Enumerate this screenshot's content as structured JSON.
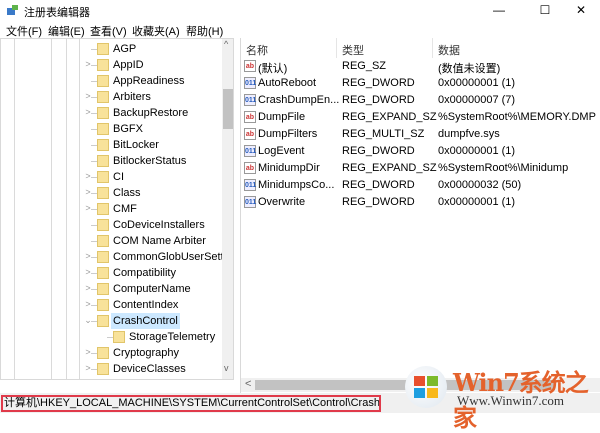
{
  "window": {
    "title": "注册表编辑器",
    "minimize": "—",
    "maximize": "☐",
    "close": "✕"
  },
  "menu": [
    "文件(F)",
    "编辑(E)",
    "查看(V)",
    "收藏夹(A)",
    "帮助(H)"
  ],
  "tree": [
    {
      "label": "AGP",
      "exp": ""
    },
    {
      "label": "AppID",
      "exp": ">"
    },
    {
      "label": "AppReadiness",
      "exp": ""
    },
    {
      "label": "Arbiters",
      "exp": ">"
    },
    {
      "label": "BackupRestore",
      "exp": ">"
    },
    {
      "label": "BGFX",
      "exp": ""
    },
    {
      "label": "BitLocker",
      "exp": ""
    },
    {
      "label": "BitlockerStatus",
      "exp": ""
    },
    {
      "label": "CI",
      "exp": ">"
    },
    {
      "label": "Class",
      "exp": ">"
    },
    {
      "label": "CMF",
      "exp": ">"
    },
    {
      "label": "CoDeviceInstallers",
      "exp": ""
    },
    {
      "label": "COM Name Arbiter",
      "exp": ""
    },
    {
      "label": "CommonGlobUserSettings",
      "exp": ">"
    },
    {
      "label": "Compatibility",
      "exp": ">"
    },
    {
      "label": "ComputerName",
      "exp": ">"
    },
    {
      "label": "ContentIndex",
      "exp": ">"
    },
    {
      "label": "CrashControl",
      "exp": "⌄",
      "selected": true
    },
    {
      "label": "StorageTelemetry",
      "exp": "",
      "child": true
    },
    {
      "label": "Cryptography",
      "exp": ">"
    },
    {
      "label": "DeviceClasses",
      "exp": ">"
    }
  ],
  "columns": {
    "name": "名称",
    "type": "类型",
    "data": "数据"
  },
  "values": [
    {
      "icon": "ab",
      "name": "(默认)",
      "type": "REG_SZ",
      "data": "(数值未设置)"
    },
    {
      "icon": "bin",
      "name": "AutoReboot",
      "type": "REG_DWORD",
      "data": "0x00000001 (1)"
    },
    {
      "icon": "bin",
      "name": "CrashDumpEn...",
      "type": "REG_DWORD",
      "data": "0x00000007 (7)"
    },
    {
      "icon": "ab",
      "name": "DumpFile",
      "type": "REG_EXPAND_SZ",
      "data": "%SystemRoot%\\MEMORY.DMP"
    },
    {
      "icon": "ab",
      "name": "DumpFilters",
      "type": "REG_MULTI_SZ",
      "data": "dumpfve.sys"
    },
    {
      "icon": "bin",
      "name": "LogEvent",
      "type": "REG_DWORD",
      "data": "0x00000001 (1)"
    },
    {
      "icon": "ab",
      "name": "MinidumpDir",
      "type": "REG_EXPAND_SZ",
      "data": "%SystemRoot%\\Minidump"
    },
    {
      "icon": "bin",
      "name": "MinidumpsCo...",
      "type": "REG_DWORD",
      "data": "0x00000032 (50)"
    },
    {
      "icon": "bin",
      "name": "Overwrite",
      "type": "REG_DWORD",
      "data": "0x00000001 (1)"
    }
  ],
  "status": {
    "path": "计算机\\HKEY_LOCAL_MACHINE\\SYSTEM\\CurrentControlSet\\Control\\CrashControl"
  },
  "watermark": {
    "brand": "Win7系统之家",
    "url": "Www.Winwin7.com"
  },
  "scroll": {
    "up": "^",
    "down": "v",
    "left": "<",
    "right": ">"
  }
}
